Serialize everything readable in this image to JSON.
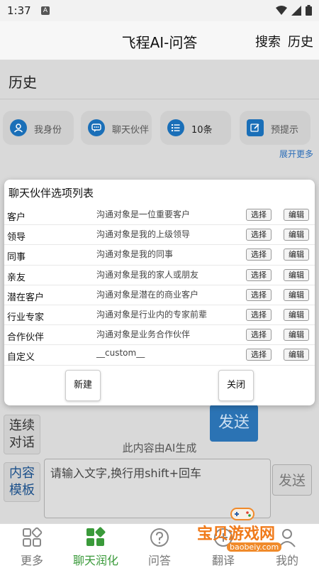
{
  "status": {
    "time": "1:37",
    "notif": "A"
  },
  "app": {
    "title": "飞程AI-问答",
    "search": "搜索",
    "history": "历史"
  },
  "history": {
    "title": "历史",
    "quick": [
      {
        "icon": "user-icon",
        "label": "我身份"
      },
      {
        "icon": "chat-icon",
        "label": "聊天伙伴"
      },
      {
        "icon": "list-icon",
        "label": "10条"
      },
      {
        "icon": "edit-icon",
        "label": "预提示"
      }
    ],
    "expand_more": "展开更多"
  },
  "dialog": {
    "title": "聊天伙伴选项列表",
    "select_label": "选择",
    "edit_label": "编辑",
    "rows": [
      {
        "name": "客户",
        "desc": "沟通对象是一位重要客户"
      },
      {
        "name": "领导",
        "desc": "沟通对象是我的上级领导"
      },
      {
        "name": "同事",
        "desc": "沟通对象是我的同事"
      },
      {
        "name": "亲友",
        "desc": "沟通对象是我的家人或朋友"
      },
      {
        "name": "潜在客户",
        "desc": "沟通对象是潜在的商业客户"
      },
      {
        "name": "行业专家",
        "desc": "沟通对象是行业内的专家前辈"
      },
      {
        "name": "合作伙伴",
        "desc": "沟通对象是业务合作伙伴"
      },
      {
        "name": "自定义",
        "desc": "__custom__"
      }
    ],
    "new_label": "新建",
    "close_label": "关闭"
  },
  "chat": {
    "continuous_line1": "连续",
    "continuous_line2": "对话",
    "template_line1": "内容",
    "template_line2": "模板",
    "send_label": "发送",
    "ai_note": "此内容由AI生成",
    "input_placeholder": "请输入文字,换行用shift+回车",
    "send_small_label": "发送"
  },
  "nav": [
    {
      "icon": "grid-icon",
      "label": "更多"
    },
    {
      "icon": "apps-icon",
      "label": "聊天润化"
    },
    {
      "icon": "question-icon",
      "label": "问答"
    },
    {
      "icon": "translate-icon",
      "label": "翻译"
    },
    {
      "icon": "profile-icon",
      "label": "我的"
    }
  ],
  "watermark": {
    "text": "宝贝游戏网",
    "url": "baobeiy.com"
  },
  "colors": {
    "accent": "#2b73b4",
    "active_nav": "#3a9a3a",
    "watermark": "#f07a1a"
  }
}
